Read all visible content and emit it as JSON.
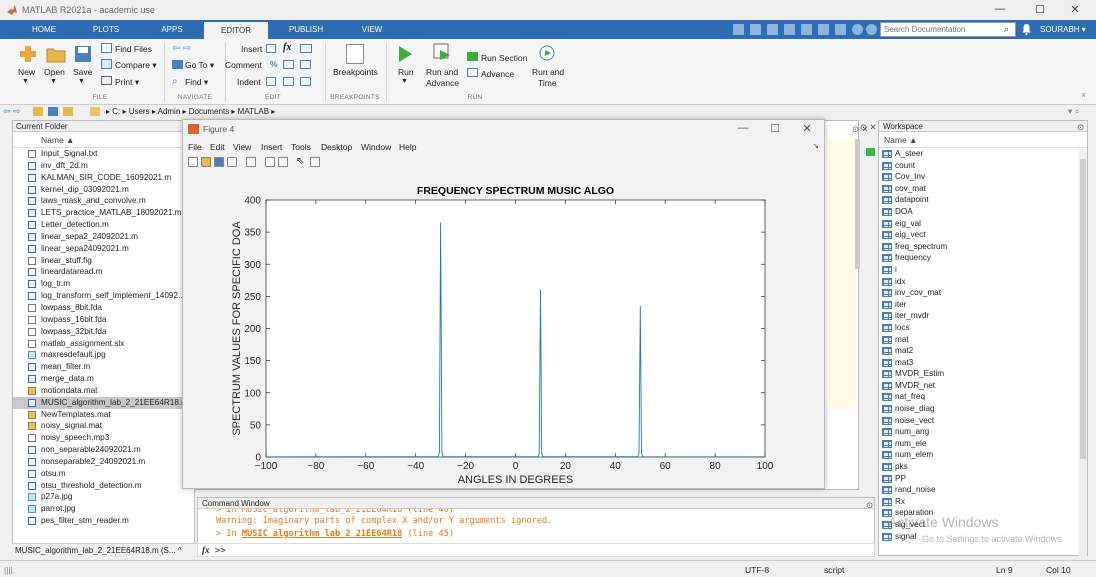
{
  "window": {
    "title": "MATLAB R2021a - academic use",
    "controls": [
      "—",
      "☐",
      "✕"
    ]
  },
  "tabs": [
    {
      "label": "HOME",
      "active": false
    },
    {
      "label": "PLOTS",
      "active": false
    },
    {
      "label": "APPS",
      "active": false
    },
    {
      "label": "EDITOR",
      "active": true
    },
    {
      "label": "PUBLISH",
      "active": false
    },
    {
      "label": "VIEW",
      "active": false
    }
  ],
  "search": {
    "placeholder": "Search Documentation"
  },
  "user": {
    "name": "SOURABH ▾"
  },
  "ribbon": {
    "file": {
      "new": "New",
      "open": "Open",
      "save": "Save",
      "find_files": "Find Files",
      "compare": "Compare ▾",
      "print": "Print ▾",
      "group": "FILE"
    },
    "navigate": {
      "goto": "Go To ▾",
      "find": "Find ▾",
      "group": "NAVIGATE"
    },
    "edit": {
      "insert": "Insert",
      "comment": "Comment",
      "indent": "Indent",
      "group": "EDIT"
    },
    "breakpoints": {
      "label": "Breakpoints",
      "group": "BREAKPOINTS"
    },
    "run": {
      "run": "Run",
      "run_advance_1": "Run and",
      "run_advance_2": "Advance",
      "run_section": "Run Section",
      "advance": "Advance",
      "run_time_1": "Run and",
      "run_time_2": "Time",
      "group": "RUN"
    }
  },
  "address": {
    "path": "▸  C: ▸ Users ▸ Admin ▸ Documents ▸ MATLAB ▸"
  },
  "current_folder": {
    "title": "Current Folder",
    "column": "Name ▲",
    "files": [
      {
        "name": "Input_Signal.txt",
        "kind": "txt"
      },
      {
        "name": "inv_dft_2d.m",
        "kind": "m"
      },
      {
        "name": "KALMAN_SIR_CODE_16092021.m",
        "kind": "m"
      },
      {
        "name": "kernel_dip_03092021.m",
        "kind": "m"
      },
      {
        "name": "laws_mask_and_convolve.m",
        "kind": "m"
      },
      {
        "name": "LETS_practice_MATLAB_18092021.m",
        "kind": "m"
      },
      {
        "name": "Letter_detection.m",
        "kind": "m"
      },
      {
        "name": "linear_sepa2_24092021.m",
        "kind": "m"
      },
      {
        "name": "linear_sepa24092021.m",
        "kind": "m"
      },
      {
        "name": "linear_stuff.fig",
        "kind": "fig"
      },
      {
        "name": "lineardataread.m",
        "kind": "m"
      },
      {
        "name": "log_tr.m",
        "kind": "m"
      },
      {
        "name": "log_transform_self_implement_14092...",
        "kind": "m"
      },
      {
        "name": "lowpass_8bit.fda",
        "kind": "txt"
      },
      {
        "name": "lowpass_16bit.fda",
        "kind": "txt"
      },
      {
        "name": "lowpass_32bit.fda",
        "kind": "txt"
      },
      {
        "name": "matlab_assignment.slx",
        "kind": "slx"
      },
      {
        "name": "maxresdefault.jpg",
        "kind": "img"
      },
      {
        "name": "mean_filter.m",
        "kind": "m"
      },
      {
        "name": "merge_data.m",
        "kind": "m"
      },
      {
        "name": "motiondata.mat",
        "kind": "mat"
      },
      {
        "name": "MUSIC_algorithm_lab_2_21EE64R18.m",
        "kind": "m",
        "selected": true
      },
      {
        "name": "NewTemplates.mat",
        "kind": "mat"
      },
      {
        "name": "noisy_signal.mat",
        "kind": "mat"
      },
      {
        "name": "noisy_speech.mp3",
        "kind": "txt"
      },
      {
        "name": "non_separable24092021.m",
        "kind": "m"
      },
      {
        "name": "nonseparable2_24092021.m",
        "kind": "m"
      },
      {
        "name": "otsu.m",
        "kind": "m"
      },
      {
        "name": "otsu_threshold_detection.m",
        "kind": "m"
      },
      {
        "name": "p27a.jpg",
        "kind": "img"
      },
      {
        "name": "parrot.jpg",
        "kind": "img"
      },
      {
        "name": "pes_filter_stm_reader.m",
        "kind": "m"
      }
    ],
    "footer": "MUSIC_algorithm_lab_2_21EE64R18.m (S...  ^"
  },
  "figure": {
    "title": "Figure 4",
    "menu": [
      "File",
      "Edit",
      "View",
      "Insert",
      "Tools",
      "Desktop",
      "Window",
      "Help"
    ]
  },
  "chart_data": {
    "type": "line",
    "title": "FREQUENCY SPECTRUM MUSIC ALGO",
    "xlabel": "ANGLES IN DEGREES",
    "ylabel": "SPECTRUM VALUES FOR SPECIFIC DOA",
    "xlim": [
      -100,
      100
    ],
    "ylim": [
      0,
      400
    ],
    "xticks": [
      -100,
      -80,
      -60,
      -40,
      -20,
      0,
      20,
      40,
      60,
      80,
      100
    ],
    "yticks": [
      0,
      50,
      100,
      150,
      200,
      250,
      300,
      350,
      400
    ],
    "series": [
      {
        "color": "#1f77b4",
        "x": [
          -100,
          -31,
          -30.5,
          -30,
          -29.5,
          -29,
          9,
          9.5,
          10,
          10.5,
          11,
          49,
          49.5,
          50,
          50.5,
          51,
          100
        ],
        "y": [
          0.3,
          0.5,
          8,
          365,
          8,
          0.5,
          0.5,
          6,
          260,
          6,
          0.5,
          0.5,
          6,
          235,
          6,
          0.5,
          0.3
        ]
      }
    ],
    "grid": false
  },
  "command_window": {
    "title": "Command Window",
    "lines": [
      {
        "text": "> In MUSIC_algorithm_lab_2_21EE64R18 (line 40)",
        "kind": "link"
      },
      {
        "text": "Warning: Imaginary parts of complex X and/or Y arguments ignored.",
        "kind": "warn"
      },
      {
        "prefix": "> In ",
        "link": "MUSIC_algorithm_lab_2_21EE64R18",
        "suffix": " (line 45)",
        "kind": "link"
      }
    ],
    "prompt": ">>",
    "fx": "fx"
  },
  "workspace": {
    "title": "Workspace",
    "column": "Name ▲",
    "vars": [
      "A_steer",
      "count",
      "Cov_Inv",
      "cov_mat",
      "datapoint",
      "DOA",
      "eig_val",
      "eig_vect",
      "freq_spectrum",
      "frequency",
      "i",
      "idx",
      "inv_cov_mat",
      "iter",
      "iter_mvdr",
      "locs",
      "mat",
      "mat2",
      "mat3",
      "MVDR_Estim",
      "MVDR_net",
      "nat_freq",
      "noise_diag",
      "noise_vect",
      "num_ang",
      "num_ele",
      "num_elem",
      "pks",
      "PP",
      "rand_noise",
      "Rx",
      "separation",
      "sig_vect",
      "signal"
    ],
    "watermark1": "Activate Windows",
    "watermark2": "Go to Settings to activate Windows."
  },
  "status": {
    "encoding": "UTF-8",
    "type": "script",
    "line": "Ln  9",
    "col": "Col  10"
  },
  "colors": {
    "ribbon_blue": "#2e6db4",
    "plot_line": "#1f77b4",
    "warning": "#e07c1b"
  }
}
